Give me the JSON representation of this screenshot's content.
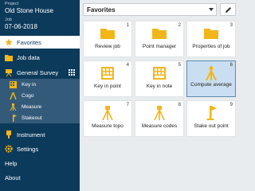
{
  "project": {
    "project_label": "Project",
    "project_name": "Old Stone House",
    "job_label": "Job",
    "job_name": "07-06-2018"
  },
  "nav": {
    "favorites": "Favorites",
    "job_data": "Job data",
    "general_survey": "General Survey",
    "sub_items": [
      "Key in",
      "Cogo",
      "Measure",
      "Stakeout"
    ],
    "instrument": "Instrument",
    "settings": "Settings",
    "help": "Help",
    "about": "About"
  },
  "header": {
    "selected_view": "Favorites"
  },
  "tiles": [
    {
      "num": "1",
      "label": "Review job",
      "icon": "folder-icon"
    },
    {
      "num": "2",
      "label": "Point manager",
      "icon": "folder-icon"
    },
    {
      "num": "3",
      "label": "Properties of job",
      "icon": "folder-icon"
    },
    {
      "num": "4",
      "label": "Key in point",
      "icon": "keypad-icon"
    },
    {
      "num": "5",
      "label": "Key in note",
      "icon": "keypad-icon"
    },
    {
      "num": "6",
      "label": "Compute average",
      "icon": "survey-rod-icon",
      "selected": true
    },
    {
      "num": "7",
      "label": "Measure topo",
      "icon": "tripod-icon"
    },
    {
      "num": "8",
      "label": "Measure codes",
      "icon": "tripod-icon"
    },
    {
      "num": "9",
      "label": "Stake out point",
      "icon": "stakeout-icon"
    }
  ],
  "colors": {
    "sidebar": "#0c3a5b",
    "submenu": "#345a79",
    "icon_yellow": "#f2b619",
    "selected_tile": "#c9def0"
  }
}
